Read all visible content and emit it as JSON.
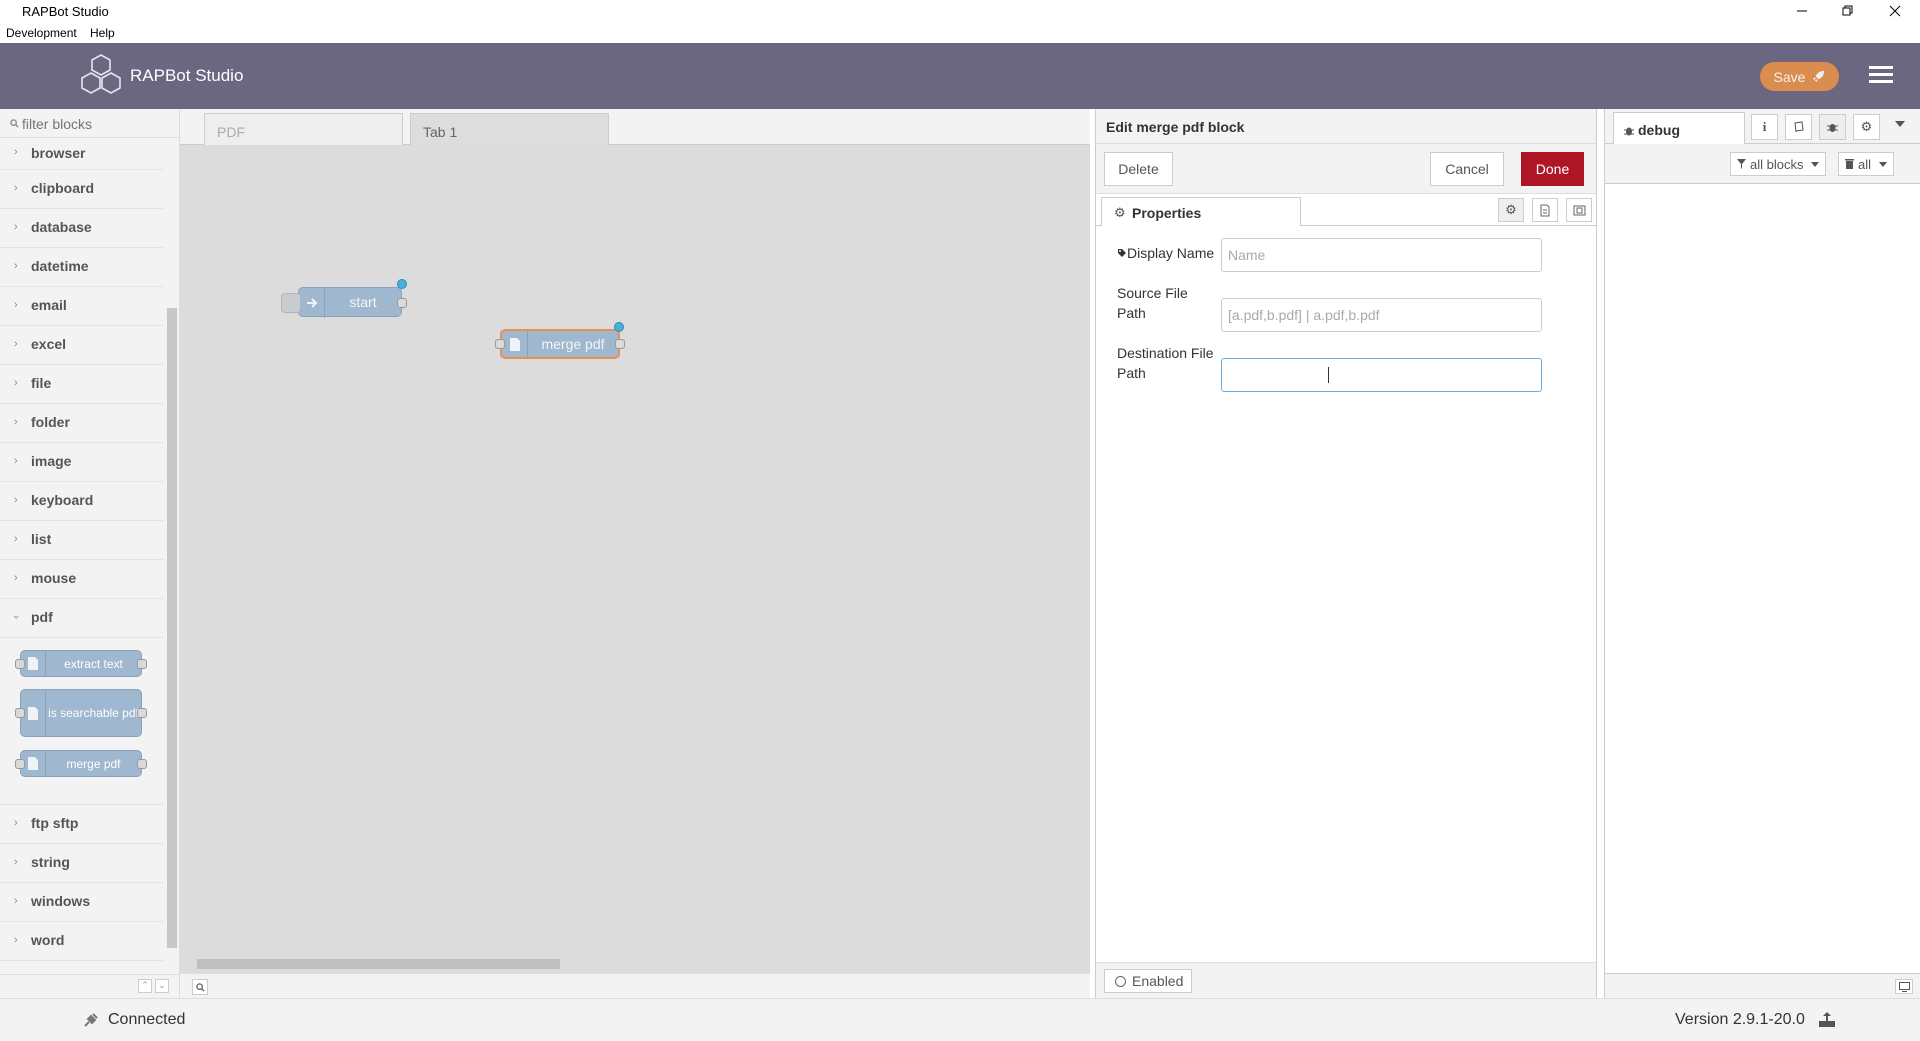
{
  "window": {
    "title": "RAPBot Studio"
  },
  "menu": {
    "development": "Development",
    "help": "Help"
  },
  "header": {
    "brand": "RAPBot Studio",
    "save_label": "Save"
  },
  "palette": {
    "filter_placeholder": "filter blocks",
    "categories_top": [
      "browser",
      "clipboard",
      "database",
      "datetime",
      "email",
      "excel",
      "file",
      "folder",
      "image",
      "keyboard",
      "list",
      "mouse"
    ],
    "pdf_category": "pdf",
    "pdf_blocks": [
      "extract text",
      "is searchable pdf",
      "merge pdf"
    ],
    "categories_bottom": [
      "ftp sftp",
      "string",
      "windows",
      "word"
    ]
  },
  "workspace": {
    "tabs": [
      "PDF",
      "Tab 1"
    ],
    "nodes": {
      "start": "start",
      "merge": "merge pdf"
    }
  },
  "tray": {
    "title": "Edit merge pdf block",
    "delete_label": "Delete",
    "cancel_label": "Cancel",
    "done_label": "Done",
    "properties_tab": "Properties",
    "fields": {
      "display_name_label": "Display Name",
      "display_name_placeholder": "Name",
      "display_name_value": "",
      "source_label_1": "Source File",
      "source_label_2": "Path",
      "source_placeholder": "[a.pdf,b.pdf] | a.pdf,b.pdf",
      "source_value": "",
      "dest_label_1": "Destination File",
      "dest_label_2": "Path",
      "dest_placeholder": "",
      "dest_value": ""
    },
    "enabled_label": "Enabled"
  },
  "sidebar": {
    "debug_tab": "debug",
    "filter_label": "all blocks",
    "clear_label": "all"
  },
  "status": {
    "connection": "Connected",
    "version": "Version 2.9.1-20.0"
  },
  "colors": {
    "header": "#6b6781",
    "save": "#e8914a",
    "done": "#ad1625",
    "node": "#9fb7cf",
    "port_active": "#4ab0d6"
  },
  "icons": [
    "minimize-icon",
    "restore-icon",
    "close-icon",
    "rocket-icon",
    "hamburger-icon",
    "search-icon",
    "tag-icon",
    "gear-icon",
    "document-icon",
    "frame-icon",
    "info-icon",
    "book-icon",
    "bug-icon",
    "filter-icon",
    "trash-icon",
    "plug-icon",
    "upload-icon",
    "monitor-icon"
  ]
}
